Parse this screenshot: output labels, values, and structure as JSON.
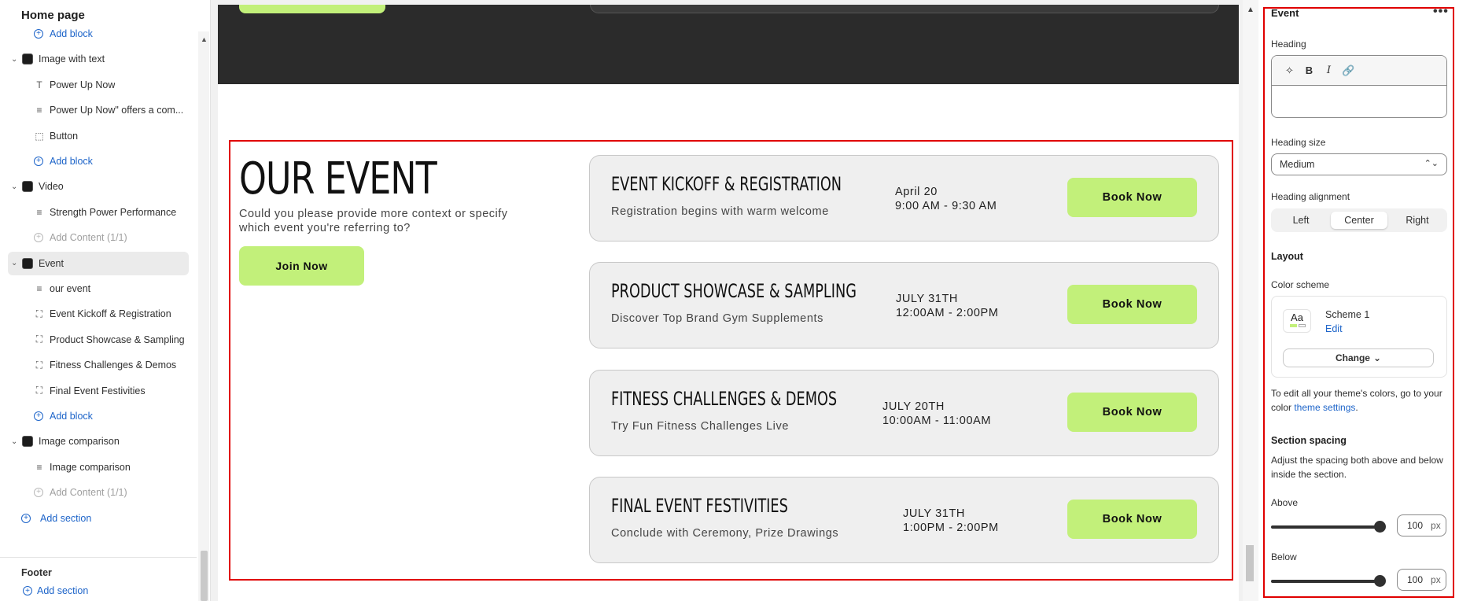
{
  "left_panel": {
    "title": "Home page",
    "tree": [
      {
        "type": "add",
        "label": "Add block"
      },
      {
        "type": "section",
        "label": "Image with text"
      },
      {
        "type": "child",
        "icon": "text-icon",
        "label": "Power Up Now"
      },
      {
        "type": "child",
        "icon": "paragraph-icon",
        "label": "Power Up Now\" offers a com..."
      },
      {
        "type": "child",
        "icon": "button-icon",
        "label": "Button"
      },
      {
        "type": "add",
        "label": "Add block"
      },
      {
        "type": "section",
        "label": "Video"
      },
      {
        "type": "child",
        "icon": "paragraph-icon",
        "label": "Strength Power Performance"
      },
      {
        "type": "add-dim",
        "label": "Add Content (1/1)"
      },
      {
        "type": "section",
        "label": "Event",
        "selected": true
      },
      {
        "type": "child",
        "icon": "paragraph-icon",
        "label": "our event"
      },
      {
        "type": "child",
        "icon": "block-icon",
        "label": "Event Kickoff & Registration"
      },
      {
        "type": "child",
        "icon": "block-icon",
        "label": "Product Showcase & Sampling"
      },
      {
        "type": "child",
        "icon": "block-icon",
        "label": "Fitness Challenges & Demos"
      },
      {
        "type": "child",
        "icon": "block-icon",
        "label": "Final Event Festivities"
      },
      {
        "type": "add",
        "label": "Add block"
      },
      {
        "type": "section",
        "label": "Image comparison"
      },
      {
        "type": "child",
        "icon": "paragraph-icon",
        "label": "Image comparison"
      },
      {
        "type": "add-dim",
        "label": "Add Content (1/1)"
      },
      {
        "type": "add-section",
        "label": "Add section"
      }
    ],
    "footer_label": "Footer",
    "footer_add": "Add section"
  },
  "event": {
    "title": "OUR EVENT",
    "description": "Could you please provide more context or specify which event you're referring to?",
    "join_label": "Join Now",
    "cards": [
      {
        "title": "EVENT KICKOFF & REGISTRATION",
        "subtitle": "Registration begins with warm welcome",
        "date": "April 20",
        "time": "9:00 AM - 9:30 AM",
        "button": "Book Now"
      },
      {
        "title": "PRODUCT SHOWCASE & SAMPLING",
        "subtitle": "Discover Top Brand Gym Supplements",
        "date": "JULY 31TH",
        "time": "12:00AM - 2:00PM",
        "button": "Book Now"
      },
      {
        "title": "FITNESS CHALLENGES & DEMOS",
        "subtitle": "Try Fun Fitness Challenges Live",
        "date": "JULY 20TH",
        "time": "10:00AM - 11:00AM",
        "button": "Book Now"
      },
      {
        "title": "FINAL EVENT FESTIVITIES",
        "subtitle": "Conclude with Ceremony, Prize Drawings",
        "date": "JULY 31TH",
        "time": "1:00PM - 2:00PM",
        "button": "Book Now"
      }
    ]
  },
  "right_panel": {
    "title": "Event",
    "more": "•••",
    "heading_label": "Heading",
    "heading_value": "",
    "heading_size_label": "Heading size",
    "heading_size_value": "Medium",
    "alignment_label": "Heading alignment",
    "alignment_options": [
      "Left",
      "Center",
      "Right"
    ],
    "alignment_selected": "Center",
    "layout_label": "Layout",
    "color_scheme_label": "Color scheme",
    "scheme_swatch": "Aa",
    "scheme_name": "Scheme 1",
    "scheme_edit": "Edit",
    "change_label": "Change",
    "colors_note_prefix": "To edit all your theme's colors, go to your color ",
    "colors_note_link": "theme settings",
    "colors_note_suffix": ".",
    "spacing_label": "Section spacing",
    "spacing_desc": "Adjust the spacing both above and below inside the section.",
    "above_label": "Above",
    "above_value": "100",
    "below_label": "Below",
    "below_value": "100",
    "unit": "px"
  },
  "colors": {
    "accent_green": "#c2f07a",
    "highlight_red": "#e00000",
    "link_blue": "#1d64c9"
  }
}
